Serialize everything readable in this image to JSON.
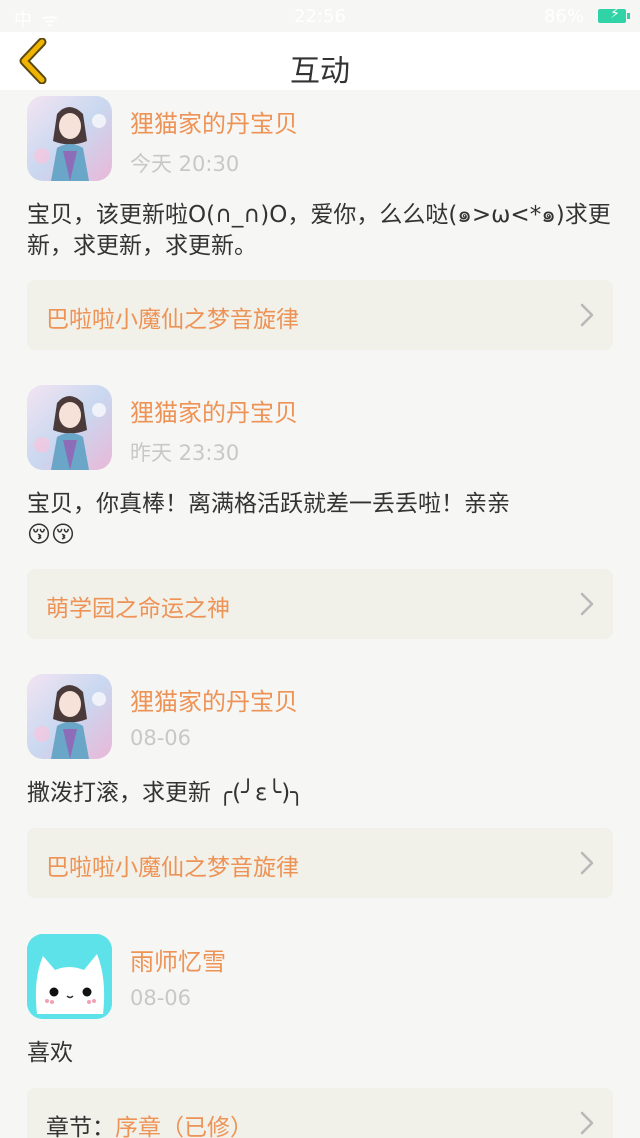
{
  "status_bar": {
    "left": "中 ᯤ",
    "time": "22:56",
    "battery_text": "86%",
    "battery_color": "#2fd3a6"
  },
  "navbar": {
    "title": "互动",
    "back_icon": "chevron-left-icon",
    "accent": "#f0b400"
  },
  "posts": [
    {
      "author": "狸猫家的丹宝贝",
      "time": "今天 20:30",
      "content": "宝贝，该更新啦O(∩_∩)O，爱你，么么哒(๑>ω<*๑)求更新，求更新，求更新。",
      "link": "巴啦啦小魔仙之梦音旋律"
    },
    {
      "author": "狸猫家的丹宝贝",
      "time": "昨天 23:30",
      "content": "宝贝，你真棒！离满格活跃就差一丢丢啦！亲亲😚😚",
      "link": "萌学园之命运之神"
    },
    {
      "author": "狸猫家的丹宝贝",
      "time": "08-06",
      "content": "撒泼打滚，求更新 ╭(╯ε╰)╮",
      "link": "巴啦啦小魔仙之梦音旋律"
    },
    {
      "author": "雨师忆雪",
      "time": "08-06",
      "content": "喜欢",
      "link_prefix": "章节：",
      "link": "序章（已修）"
    }
  ],
  "colors": {
    "author": "#ee9356",
    "time": "#c8c8c8",
    "card_bg": "#f1f0e9",
    "page_bg": "#f6f6f4"
  }
}
